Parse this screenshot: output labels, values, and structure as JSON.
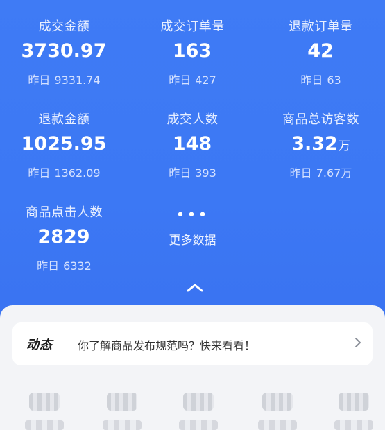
{
  "stats": [
    {
      "label": "成交金额",
      "value": "3730.97",
      "unit": "",
      "prev_label": "昨日",
      "prev_value": "9331.74"
    },
    {
      "label": "成交订单量",
      "value": "163",
      "unit": "",
      "prev_label": "昨日",
      "prev_value": "427"
    },
    {
      "label": "退款订单量",
      "value": "42",
      "unit": "",
      "prev_label": "昨日",
      "prev_value": "63"
    },
    {
      "label": "退款金额",
      "value": "1025.95",
      "unit": "",
      "prev_label": "昨日",
      "prev_value": "1362.09"
    },
    {
      "label": "成交人数",
      "value": "148",
      "unit": "",
      "prev_label": "昨日",
      "prev_value": "393"
    },
    {
      "label": "商品总访客数",
      "value": "3.32",
      "unit": "万",
      "prev_label": "昨日",
      "prev_value": "7.67万"
    },
    {
      "label": "商品点击人数",
      "value": "2829",
      "unit": "",
      "prev_label": "昨日",
      "prev_value": "6332"
    }
  ],
  "more": {
    "dots": "•••",
    "label": "更多数据",
    "icon": "more-dots-icon"
  },
  "collapse": {
    "icon": "chevron-up-icon"
  },
  "notice": {
    "tag": "动态",
    "message": "你了解商品发布规范吗？快来看看！",
    "icon": "chevron-right-icon"
  },
  "colors": {
    "hero_bg": "#3c78f4",
    "panel_bg": "#f3f4f7",
    "card_bg": "#ffffff"
  }
}
